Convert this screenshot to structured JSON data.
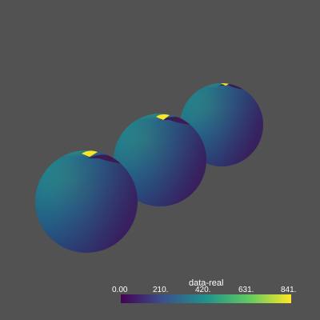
{
  "viewport": {
    "background": "#525252",
    "spheres_count": 3
  },
  "colorbar": {
    "title": "data-real",
    "ticks": [
      "0.00",
      "210.",
      "420.",
      "631.",
      "841."
    ],
    "range": [
      0,
      841
    ],
    "colormap": "viridis",
    "colormap_stops": [
      "#440154",
      "#3b528b",
      "#21918c",
      "#5ec962",
      "#fde725"
    ]
  }
}
